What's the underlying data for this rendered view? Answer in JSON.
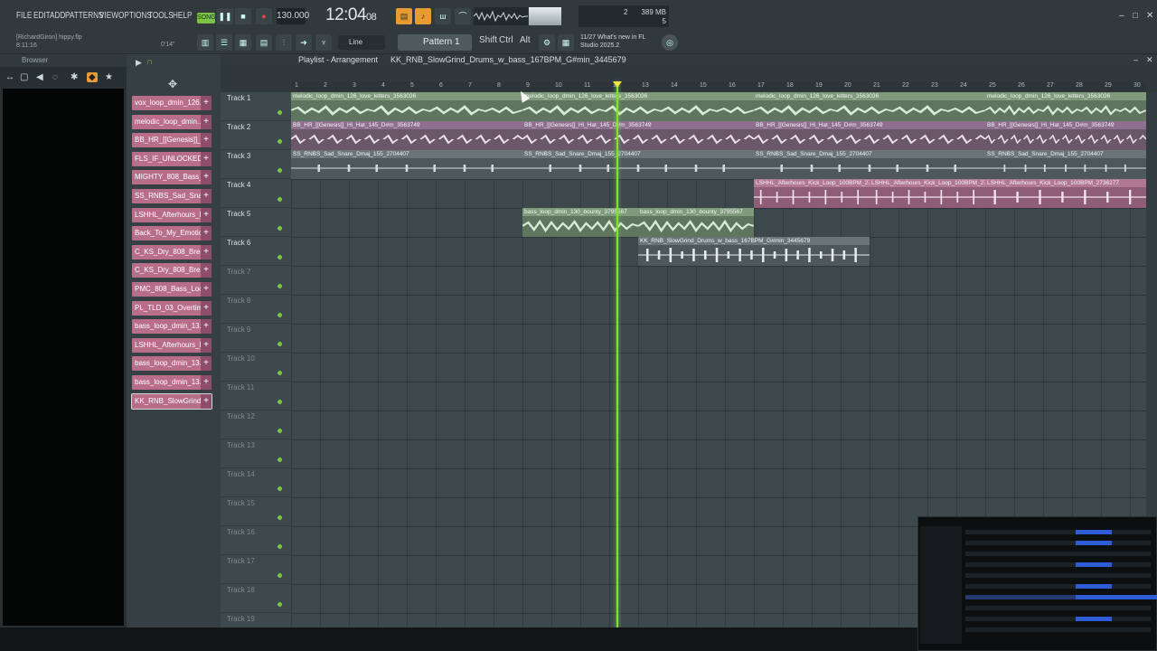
{
  "menu": [
    "FILE",
    "EDIT",
    "ADD",
    "PATTERNS",
    "VIEW",
    "OPTIONS",
    "TOOLS",
    "HELP"
  ],
  "transport": {
    "mode": "SONG",
    "tempo": "130.000",
    "time_main": "12:04",
    "time_sub": "08"
  },
  "cpu": {
    "a": "2",
    "mem": "389 MB",
    "poly": "5"
  },
  "hint": {
    "user": "[RichardGiron]",
    "project": "hippy.flp",
    "time": "8:11:16",
    "pos": "0'14\""
  },
  "snap": "Line",
  "pattern": "Pattern 1",
  "modifiers": [
    "Shift",
    "Ctrl",
    "Alt"
  ],
  "news": {
    "count": "11/27",
    "line1": "What's new in FL",
    "line2": "Studio 2025.2"
  },
  "browser": {
    "title": "Browser"
  },
  "picker_items": [
    "vox_loop_dmin_126...",
    "melodic_loop_dmin...",
    "BB_HR_[[Genesis]]_...",
    "FLS_IF_UNLOCKED_[[...",
    "MIGHTY_808_Bass_(1...",
    "SS_RNBS_Sad_Snare_...",
    "LSHHL_Afterhours_Ki...",
    "Back_To_My_Emotio...",
    "C_KS_Dry_808_Break...",
    "C_KS_Dry_808_Break...",
    "PMC_808_Bass_Loo...",
    "PL_TLD_03_Overtime...",
    "bass_loop_dmin_13...",
    "LSHHL_Afterhours_Ki...",
    "bass_loop_dmin_13...",
    "bass_loop_dmin_13...",
    "KK_RNB_SlowGrind_..."
  ],
  "playlist": {
    "title": "Playlist - Arrangement",
    "song": "KK_RNB_SlowGrind_Drums_w_bass_167BPM_G#min_3445679",
    "ruler": [
      "1",
      "2",
      "3",
      "4",
      "5",
      "6",
      "7",
      "8",
      "9",
      "10",
      "11",
      "12",
      "13",
      "14",
      "15",
      "16",
      "17",
      "18",
      "19",
      "20",
      "21",
      "22",
      "23",
      "24",
      "25",
      "26",
      "27",
      "28",
      "29",
      "30"
    ],
    "tracks": [
      "Track 1",
      "Track 2",
      "Track 3",
      "Track 4",
      "Track 5",
      "Track 6",
      "Track 7",
      "Track 8",
      "Track 9",
      "Track 10",
      "Track 11",
      "Track 12",
      "Track 13",
      "Track 14",
      "Track 15",
      "Track 16",
      "Track 17",
      "Track 18",
      "Track 19"
    ],
    "clips": {
      "t1": "melodic_loop_dmin_126_love_letters_3563036",
      "t2": "BB_HR_[[Genesis]]_Hi_Hat_145_D#m_3563749",
      "t3": "SS_RNBS_Sad_Snare_Dmaj_155_2704407",
      "t4": "LSHHL_Afterhours_Kick_Loop_100BPM_2736277",
      "t5a": "bass_loop_dmin_130_bounty_3795567",
      "t5b": "bass_loop_dmin_130_bounty_3795567",
      "t6": "KK_RNB_SlowGrind_Drums_w_bass_167BPM_G#min_3445679"
    }
  }
}
